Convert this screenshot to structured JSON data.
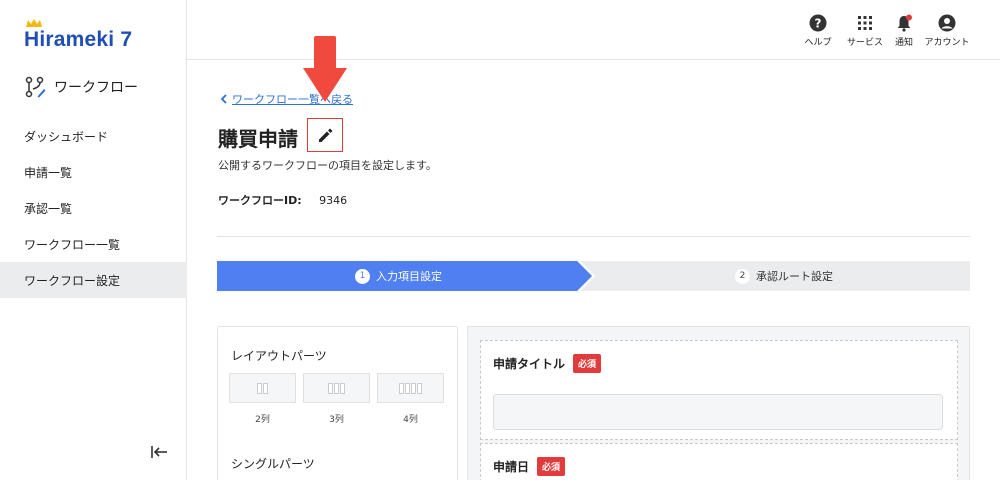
{
  "app": {
    "logo_text": "Hirameki 7"
  },
  "sidebar": {
    "section_label": "ワークフロー",
    "items": [
      {
        "label": "ダッシュボード",
        "active": false
      },
      {
        "label": "申請一覧",
        "active": false
      },
      {
        "label": "承認一覧",
        "active": false
      },
      {
        "label": "ワークフロー一覧",
        "active": false
      },
      {
        "label": "ワークフロー設定",
        "active": true
      }
    ],
    "collapse_icon": "collapse-left-icon"
  },
  "topbar": {
    "items": [
      {
        "label": "ヘルプ",
        "icon": "help-icon"
      },
      {
        "label": "サービス",
        "icon": "grid-icon"
      },
      {
        "label": "通知",
        "icon": "bell-icon"
      },
      {
        "label": "アカウント",
        "icon": "account-icon"
      }
    ]
  },
  "main": {
    "back_link": "ワークフロー一覧へ戻る",
    "title": "購買申請",
    "subtitle": "公開するワークフローの項目を設定します。",
    "workflow_id_label": "ワークフローID:",
    "workflow_id_value": "9346"
  },
  "steps": [
    {
      "num": "1",
      "label": "入力項目設定",
      "active": true
    },
    {
      "num": "2",
      "label": "承認ルート設定",
      "active": false
    }
  ],
  "parts_panel": {
    "layout_heading": "レイアウトパーツ",
    "layouts": [
      {
        "label": "2列",
        "cols": 2
      },
      {
        "label": "3列",
        "cols": 3
      },
      {
        "label": "4列",
        "cols": 4
      }
    ],
    "single_heading": "シングルパーツ"
  },
  "form_fields": [
    {
      "label": "申請タイトル",
      "required_badge": "必須"
    },
    {
      "label": "申請日",
      "required_badge": "必須"
    }
  ],
  "colors": {
    "brand": "#1f4fb5",
    "step_active": "#4f7ff0",
    "step_inactive": "#ebecee",
    "required": "#e23b3b",
    "link": "#2a6fd6",
    "arrow": "#f04a3e"
  }
}
